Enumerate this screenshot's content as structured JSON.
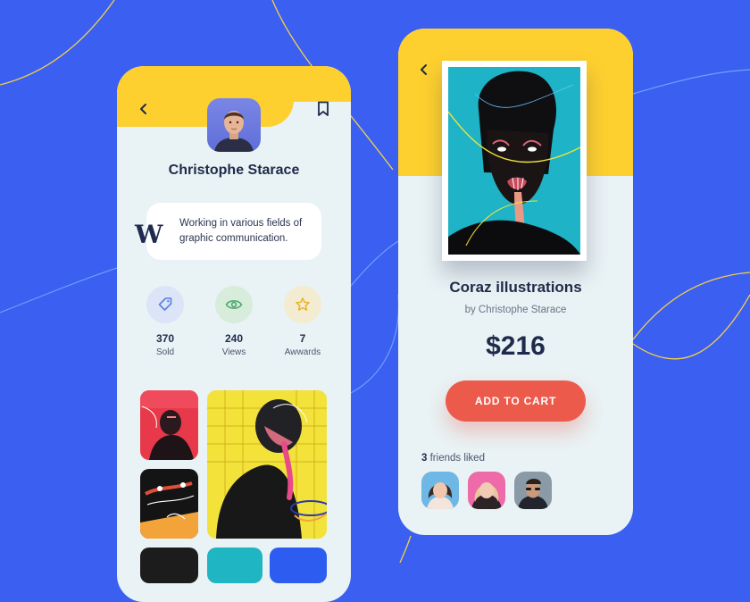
{
  "profile": {
    "name": "Christophe Starace",
    "bio_logo": "W",
    "bio_text": "Working in various fields of graphic communication."
  },
  "stats": [
    {
      "value": "370",
      "label": "Sold",
      "icon": "tag-icon",
      "bg": "#dbe5f7",
      "color": "#5a7fe0"
    },
    {
      "value": "240",
      "label": "Views",
      "icon": "eye-icon",
      "bg": "#d8ecdc",
      "color": "#47a86a"
    },
    {
      "value": "7",
      "label": "Awwards",
      "icon": "star-icon",
      "bg": "#f3ecd0",
      "color": "#e8b52a"
    }
  ],
  "product": {
    "title": "Coraz illustrations",
    "by": "by Christophe Starace",
    "price": "$216",
    "cta": "ADD TO CART"
  },
  "friends": {
    "count": "3",
    "label": "friends liked"
  },
  "colors": {
    "background": "#3b5ff0",
    "yellow": "#fed02f",
    "card": "#e9f2f4",
    "accent": "#ec5a4b",
    "text": "#1e2b4a"
  }
}
